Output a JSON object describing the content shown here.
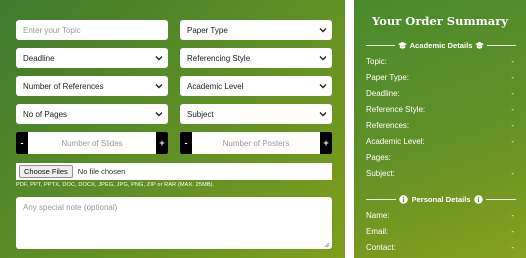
{
  "form": {
    "topic_placeholder": "Enter your Topic",
    "paper_type": "Paper Type",
    "deadline": "Deadline",
    "referencing_style": "Referencing Style",
    "number_of_references": "Number of References",
    "academic_level": "Academic Level",
    "no_of_pages": "No of Pages",
    "subject": "Subject",
    "slides": {
      "minus": "-",
      "placeholder": "Number of Slides",
      "plus": "+"
    },
    "posters": {
      "minus": "-",
      "placeholder": "Number of Posters",
      "plus": "+"
    },
    "file": {
      "button": "Choose Files",
      "status": "No file chosen",
      "hint": "PDF, PPT, PPTX, DOC, DOCX, JPEG, JPG, PNG, ZIP or RAR (MAX. 25MB)."
    },
    "note_placeholder": "Any special note (optional)"
  },
  "summary": {
    "title": "Your Order Summary",
    "academic_header": "Academic Details",
    "academic_rows": [
      {
        "label": "Topic:",
        "value": "-"
      },
      {
        "label": "Paper Type:",
        "value": "-"
      },
      {
        "label": "Deadline:",
        "value": "-"
      },
      {
        "label": "Reference Style:",
        "value": "-"
      },
      {
        "label": "References:",
        "value": "-"
      },
      {
        "label": "Academic Level:",
        "value": "-"
      },
      {
        "label": "Pages:",
        "value": ""
      },
      {
        "label": "Subject:",
        "value": "-"
      }
    ],
    "personal_header": "Personal Details",
    "personal_rows": [
      {
        "label": "Name:",
        "value": "-"
      },
      {
        "label": "Email:",
        "value": "-"
      },
      {
        "label": "Contact:",
        "value": "-"
      }
    ]
  },
  "icons": {
    "academic": "graduation-cap-icon",
    "personal": "info-icon",
    "select": "chevron-down-icon"
  },
  "colors": {
    "panel_green": "#5a8d26",
    "stepper_button": "#000000"
  }
}
